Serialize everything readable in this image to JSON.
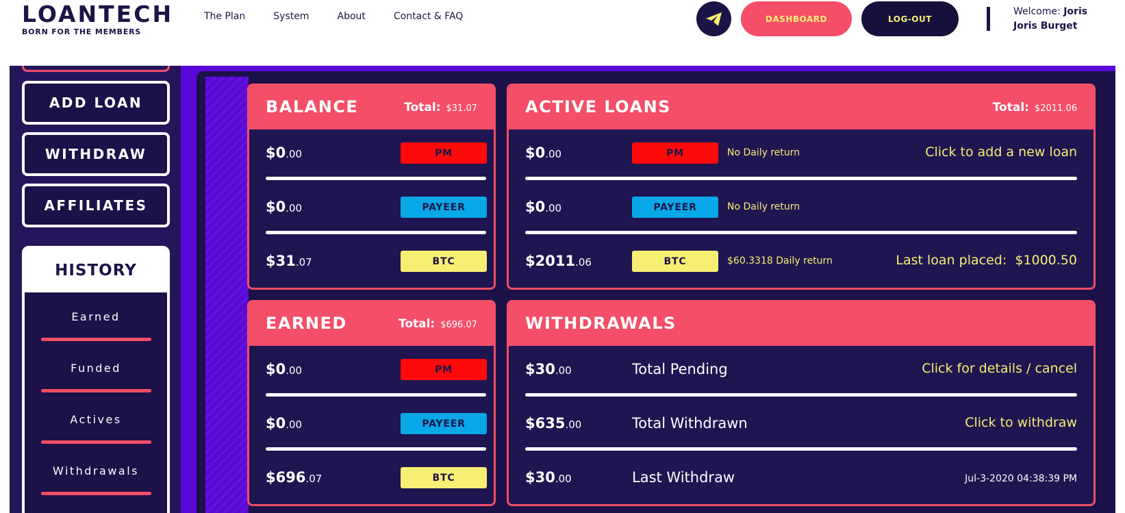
{
  "header": {
    "logo": "LOANTECH",
    "tagline": "BORN FOR THE MEMBERS",
    "nav": [
      "The Plan",
      "System",
      "About",
      "Contact & FAQ"
    ],
    "dashboard_label": "DASHBOARD",
    "logout_label": "LOG-OUT",
    "welcome_label": "Welcome:",
    "welcome_first": "Joris",
    "welcome_full": "Joris Burget"
  },
  "sidebar": {
    "buttons": [
      "ADD LOAN",
      "WITHDRAW",
      "AFFILIATES"
    ],
    "history_title": "HISTORY",
    "history_items": [
      "Earned",
      "Funded",
      "Actives",
      "Withdrawals"
    ]
  },
  "balance": {
    "title": "BALANCE",
    "total_label": "Total:",
    "total": "$31.07",
    "rows": [
      {
        "whole": "$0",
        "cents": ".00",
        "tag": "PM"
      },
      {
        "whole": "$0",
        "cents": ".00",
        "tag": "PAYEER"
      },
      {
        "whole": "$31",
        "cents": ".07",
        "tag": "BTC"
      }
    ]
  },
  "active_loans": {
    "title": "ACTIVE LOANS",
    "total_label": "Total:",
    "total": "$2011.06",
    "rows": [
      {
        "whole": "$0",
        "cents": ".00",
        "tag": "PM",
        "note": "No Daily return"
      },
      {
        "whole": "$0",
        "cents": ".00",
        "tag": "PAYEER",
        "note": "No Daily return"
      },
      {
        "whole": "$2011",
        "cents": ".06",
        "tag": "BTC",
        "note": "$60.3318 Daily return"
      }
    ],
    "add_link": "Click to add a new loan",
    "last_label": "Last loan placed:",
    "last_value": "$1000.50"
  },
  "earned": {
    "title": "EARNED",
    "total_label": "Total:",
    "total": "$696.07",
    "rows": [
      {
        "whole": "$0",
        "cents": ".00",
        "tag": "PM"
      },
      {
        "whole": "$0",
        "cents": ".00",
        "tag": "PAYEER"
      },
      {
        "whole": "$696",
        "cents": ".07",
        "tag": "BTC"
      }
    ]
  },
  "withdrawals": {
    "title": "WITHDRAWALS",
    "rows": [
      {
        "whole": "$30",
        "cents": ".00",
        "label": "Total Pending",
        "link": "Click for details / cancel"
      },
      {
        "whole": "$635",
        "cents": ".00",
        "label": "Total Withdrawn",
        "link": "Click to withdraw"
      },
      {
        "whole": "$30",
        "cents": ".00",
        "label": "Last Withdraw",
        "link": "Jul-3-2020 04:38:39 PM"
      }
    ]
  },
  "colors": {
    "accent": "#f44e68",
    "navy": "#1b1446",
    "purple": "#5a08d8",
    "yellow": "#f7ef73"
  }
}
